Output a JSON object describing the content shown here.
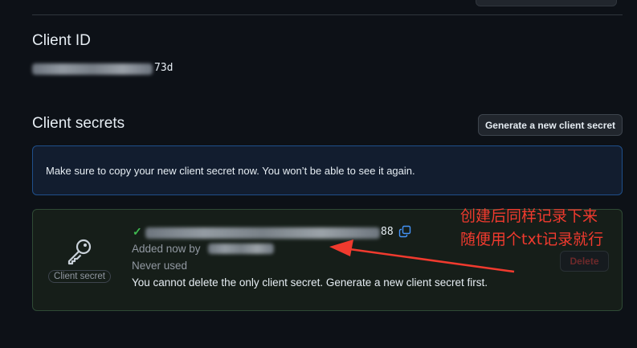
{
  "client_id": {
    "title": "Client ID",
    "value_visible_suffix": "73d"
  },
  "client_secrets": {
    "title": "Client secrets",
    "generate_button_label": "Generate a new client secret",
    "flash_message": "Make sure to copy your new client secret now. You won’t be able to see it again.",
    "secret": {
      "badge_label": "Client secret",
      "value_visible_suffix": "88",
      "added_text": "Added now by",
      "usage_text": "Never used",
      "warning_text": "You cannot delete the only client secret. Generate a new client secret first.",
      "delete_button_label": "Delete"
    }
  },
  "annotation": {
    "lines": [
      "创建后同样记录下来",
      "随便用个txt记录就行"
    ],
    "color": "#f03a2e"
  },
  "icons": {
    "check": "check-icon",
    "key": "key-icon",
    "copy": "copy-icon",
    "arrow": "red-arrow-annotation"
  },
  "colors": {
    "background": "#0d1117",
    "success": "#3fb950",
    "accent_blue": "#4493f8",
    "danger_muted": "#8b2d30"
  }
}
